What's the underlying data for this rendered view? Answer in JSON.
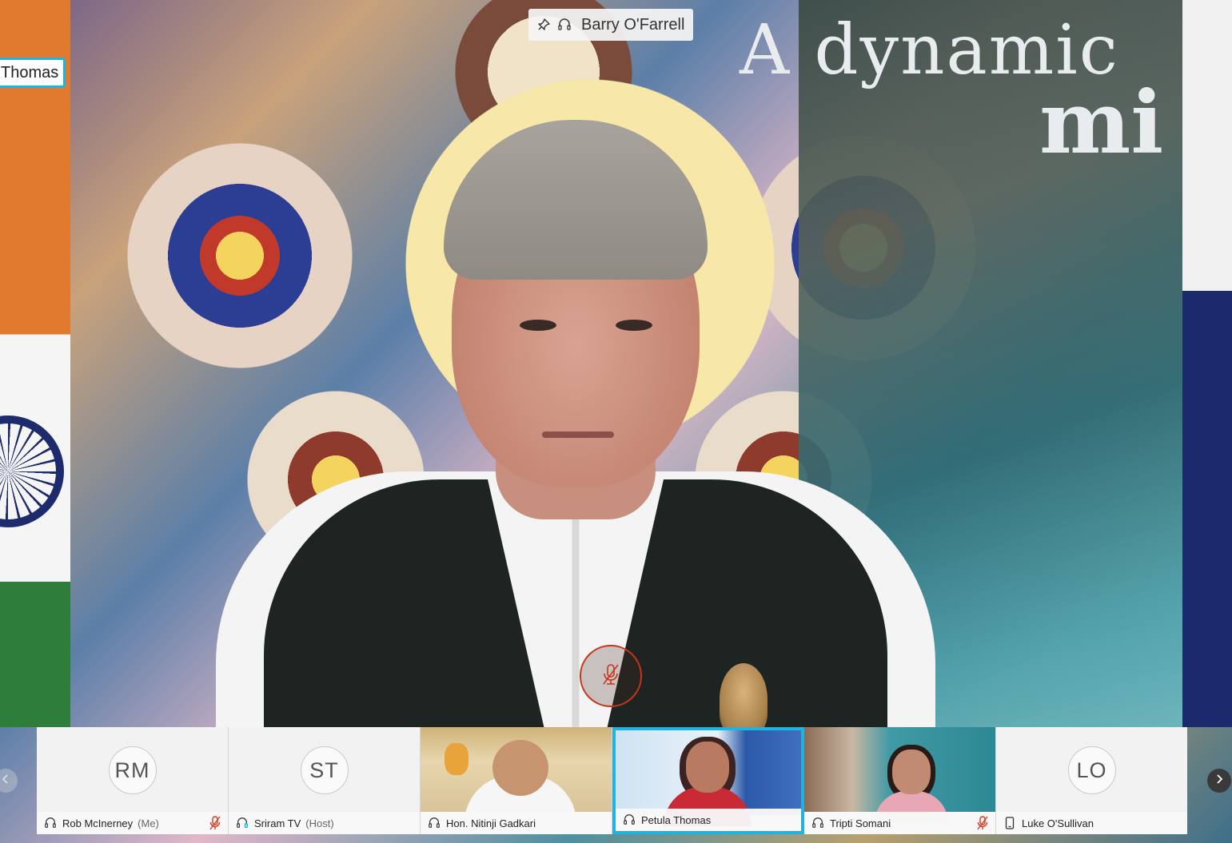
{
  "main_video": {
    "speaker_name": "Barry O'Farrell",
    "background_text_line1": "A dynamic",
    "background_text_line2": "mi",
    "side_label": "Thomas"
  },
  "icons": {
    "pin": "pin-icon",
    "headset": "headset-icon",
    "mic_muted": "mic-muted-icon",
    "phone": "phone-icon",
    "chevron_left": "chevron-left-icon",
    "chevron_right": "chevron-right-icon"
  },
  "colors": {
    "active_border": "#1fb3e0",
    "mute_red": "#c8341a"
  },
  "participants": [
    {
      "initials": "RM",
      "name": "Rob McInerney",
      "role": "(Me)",
      "muted": true
    },
    {
      "initials": "ST",
      "name": "Sriram TV",
      "role": "(Host)",
      "muted": false
    },
    {
      "initials": "",
      "name": "Hon. Nitinji Gadkari",
      "role": "",
      "muted": false
    },
    {
      "initials": "",
      "name": "Petula Thomas",
      "role": "",
      "muted": false,
      "active": true
    },
    {
      "initials": "",
      "name": "Tripti Somani",
      "role": "",
      "muted": true
    },
    {
      "initials": "LO",
      "name": "Luke O'Sullivan",
      "role": "",
      "muted": false
    }
  ]
}
